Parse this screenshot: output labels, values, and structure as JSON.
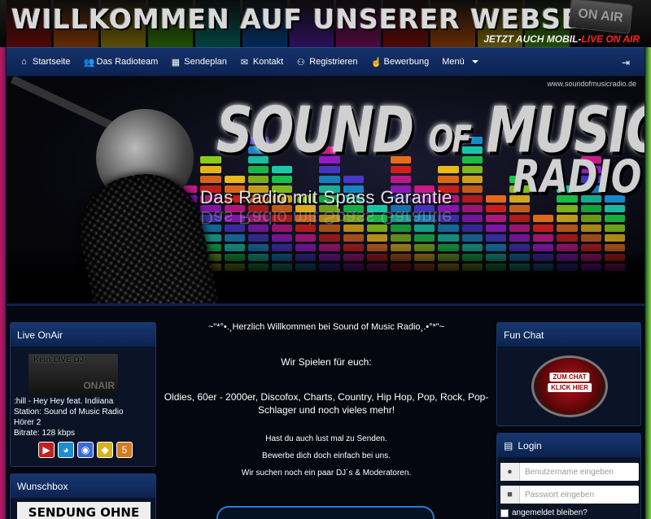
{
  "banner": {
    "title": "WILLKOMMEN AUF UNSERER WEBSEITE",
    "mobile_prefix": "JETZT AUCH MOBIL-",
    "mobile_live": "LIVE ON AIR",
    "onair_sign": "ON AIR"
  },
  "nav": {
    "items": [
      {
        "label": "Startseite",
        "icon": "home-icon"
      },
      {
        "label": "Das Radioteam",
        "icon": "users-icon"
      },
      {
        "label": "Sendeplan",
        "icon": "calendar-icon"
      },
      {
        "label": "Kontakt",
        "icon": "envelope-icon"
      },
      {
        "label": "Registrieren",
        "icon": "user-plus-icon"
      },
      {
        "label": "Bewerbung",
        "icon": "thumbs-up-icon"
      },
      {
        "label": "Menü",
        "icon": "caret-down-icon"
      }
    ],
    "logout_icon": "sign-out-icon"
  },
  "hero": {
    "url": "www.soundofmusicradio.de",
    "title_part1": "SOUND",
    "title_part2": "OF",
    "title_part3": "MUSIC",
    "title_radio": "RADIO",
    "slogan": "Das Radio mit Spass Garantie"
  },
  "live_onair": {
    "heading": "Live OnAir",
    "image_text1": "Kein LIVE DJ",
    "image_text2": "ONAIR",
    "track": ":hill - Hey Hey feat. Indiiana",
    "station": "Station: Sound of Music Radio",
    "listeners": "Hörer 2",
    "bitrate": "Bitrate: 128 kbps"
  },
  "wunschbox": {
    "heading": "Wunschbox",
    "image_text": "SENDUNG OHNE"
  },
  "center": {
    "welcome": "~\"*°•.¸Herzlich Willkommen bei Sound of Music Radio¸.•°*\"~",
    "spielen": "Wir Spielen für euch:",
    "genres": "Oldies, 60er - 2000er, Discofox, Charts, Country, Hip Hop, Pop, Rock, Pop-Schlager und noch vieles mehr!",
    "lust": "Hast du auch lust mal zu Senden.",
    "bewerbe": "Bewerbe dich doch einfach bei uns.",
    "suchen": "Wir suchen noch ein paar DJ´s & Moderatoren."
  },
  "fun_chat": {
    "heading": "Fun Chat",
    "badge_line1": "ZUM CHAT",
    "badge_line2": "KLICK HIER"
  },
  "login": {
    "heading": "Login",
    "username_placeholder": "Benutzername eingeben",
    "password_placeholder": "Passwort eingeben",
    "remember": "angemeldet bleiben?"
  },
  "colors": {
    "nav_bg": "#15336a",
    "page_bg": "#04070f",
    "live_red": "#ff2020"
  }
}
